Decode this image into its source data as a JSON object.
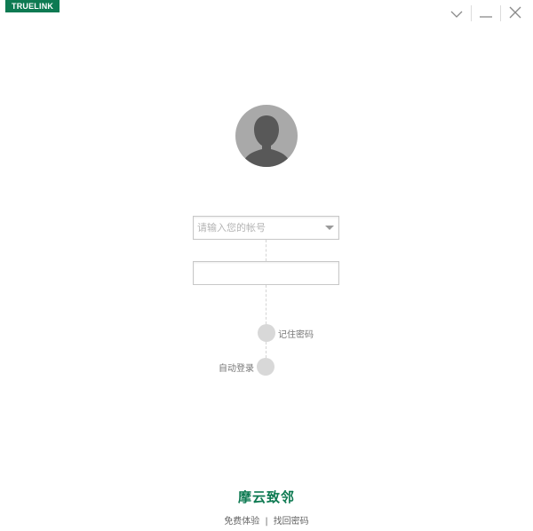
{
  "brand_tag": "TRUELINK",
  "window_controls": {
    "collapse_icon": "chevron-down-icon",
    "minimize_icon": "minimize-icon",
    "close_icon": "close-icon"
  },
  "avatar": {
    "icon": "user-silhouette-icon"
  },
  "login": {
    "account_placeholder": "请输入您的帐号",
    "account_value": "",
    "password_placeholder": "",
    "password_value": ""
  },
  "options": {
    "remember_password": "记住密码",
    "auto_login": "自动登录"
  },
  "footer": {
    "brand_name": "摩云致邻",
    "free_trial": "免费体验",
    "separator": "|",
    "retrieve_password": "找回密码"
  },
  "colors": {
    "brand_green": "#0e7a52",
    "avatar_gray": "#a9a9a9",
    "toggle_gray": "#d8d8d8"
  }
}
